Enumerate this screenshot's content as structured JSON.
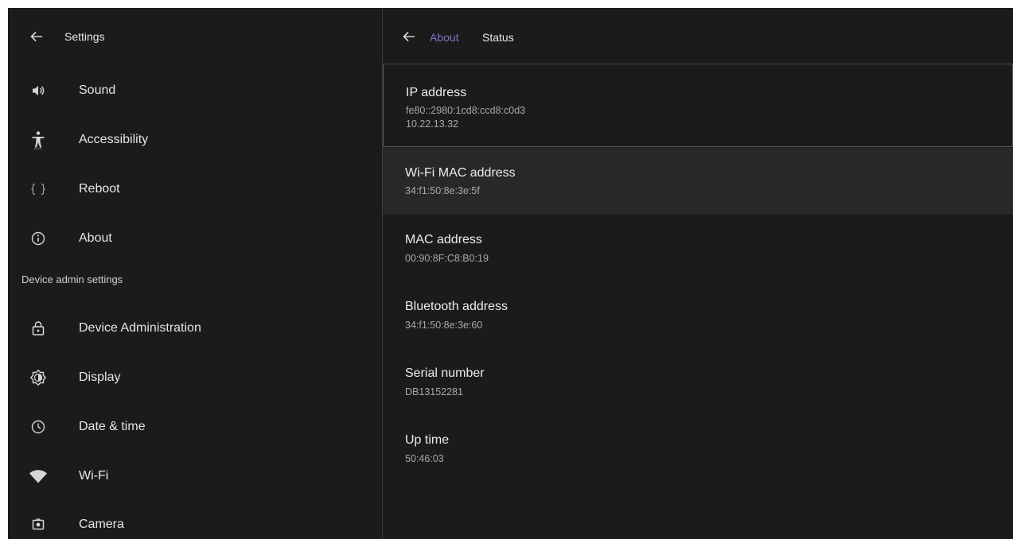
{
  "settings_panel": {
    "title": "Settings",
    "items_top": [
      {
        "label": "Sound",
        "icon": "speaker-icon"
      },
      {
        "label": "Accessibility",
        "icon": "accessibility-icon"
      },
      {
        "label": "Reboot",
        "icon": "braces-icon"
      },
      {
        "label": "About",
        "icon": "info-icon"
      }
    ],
    "section_label": "Device admin settings",
    "items_admin": [
      {
        "label": "Device Administration",
        "icon": "lock-icon"
      },
      {
        "label": "Display",
        "icon": "brightness-icon"
      },
      {
        "label": "Date & time",
        "icon": "clock-icon"
      },
      {
        "label": "Wi-Fi",
        "icon": "wifi-icon"
      },
      {
        "label": "Camera",
        "icon": "camera-icon"
      }
    ]
  },
  "status_panel": {
    "breadcrumb_parent": "About",
    "breadcrumb_current": "Status",
    "items": [
      {
        "title": "IP address",
        "values": [
          "fe80::2980:1cd8:ccd8:c0d3",
          "10.22.13.32"
        ]
      },
      {
        "title": "Wi-Fi MAC address",
        "values": [
          "34:f1:50:8e:3e:5f"
        ]
      },
      {
        "title": "MAC address",
        "values": [
          "00:90:8F:C8:B0:19"
        ]
      },
      {
        "title": "Bluetooth address",
        "values": [
          "34:f1:50:8e:3e:60"
        ]
      },
      {
        "title": "Serial number",
        "values": [
          "DB13152281"
        ]
      },
      {
        "title": "Up time",
        "values": [
          "50:46:03"
        ]
      }
    ]
  },
  "colors": {
    "background": "#1b1b1b",
    "accent": "#7e73c8",
    "selected_row": "#282828"
  }
}
